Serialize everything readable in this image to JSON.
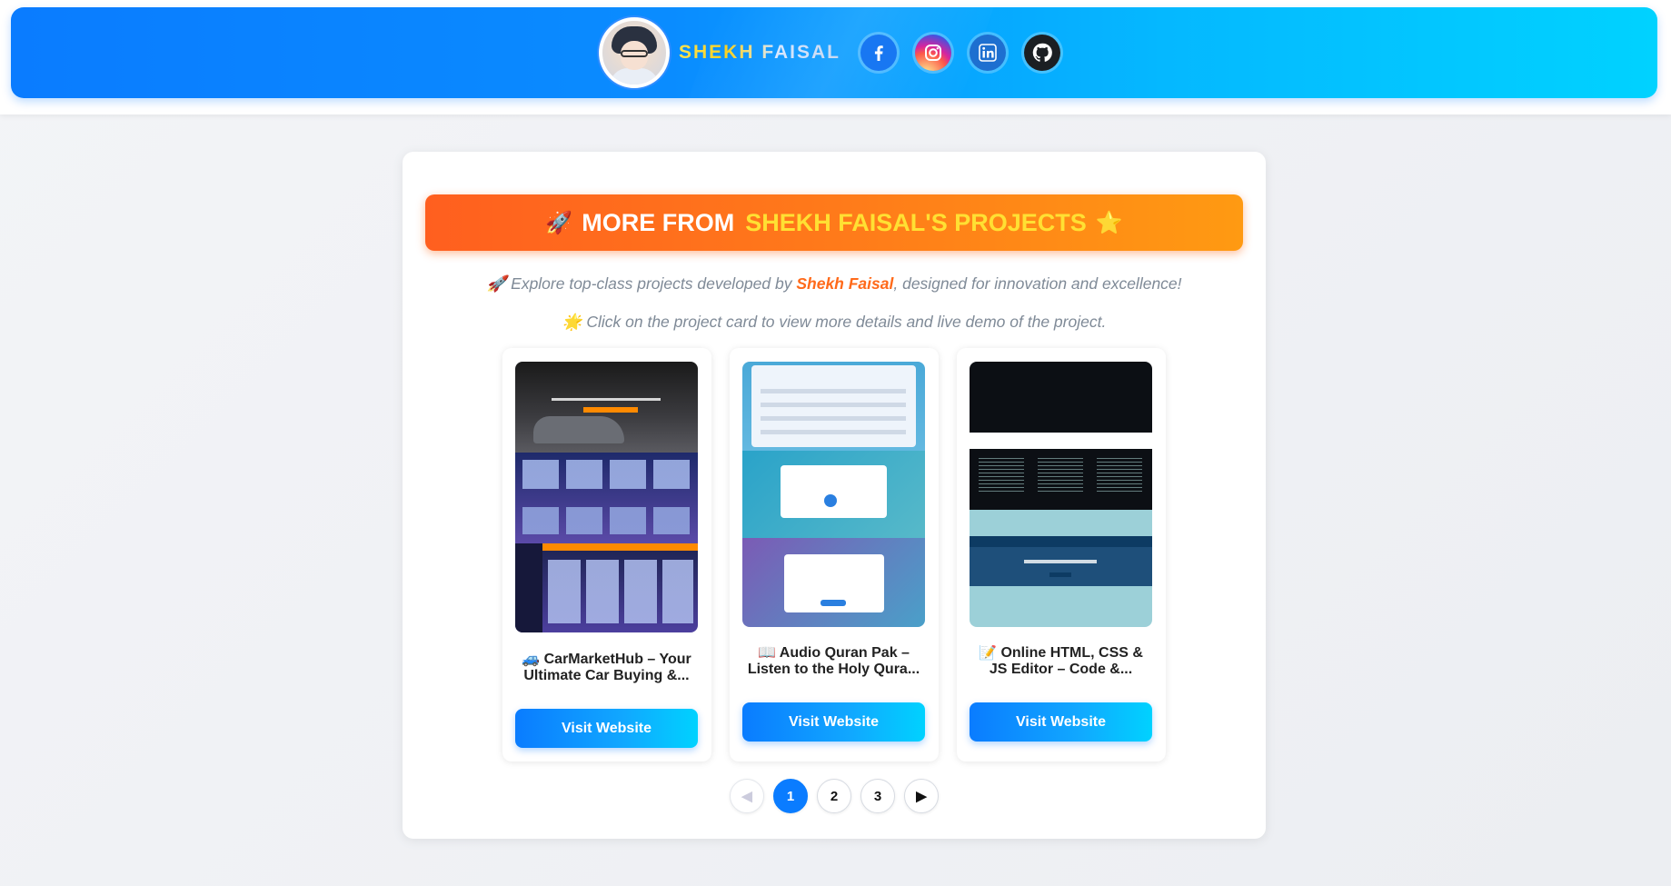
{
  "header": {
    "brand": "SHEKH FAISAL",
    "socials": [
      {
        "name": "facebook",
        "icon": "facebook-icon"
      },
      {
        "name": "instagram",
        "icon": "instagram-icon"
      },
      {
        "name": "linkedin",
        "icon": "linkedin-icon"
      },
      {
        "name": "github",
        "icon": "github-icon"
      }
    ]
  },
  "banner": {
    "emoji_left": "🚀",
    "prefix": "MORE FROM",
    "highlight": "SHEKH FAISAL'S PROJECTS",
    "emoji_right": "⭐"
  },
  "intro": {
    "line1_emoji": "🚀",
    "line1_before": "Explore top-class projects developed by",
    "line1_name": "Shekh Faisal",
    "line1_after": ", designed for innovation and excellence!",
    "line2_emoji": "🌟",
    "line2": "Click on the project card to view more details and live demo of the project."
  },
  "projects": [
    {
      "title_l1": "🚙 CarMarketHub – Your",
      "title_l2": "Ultimate Car Buying &...",
      "button": "Visit Website"
    },
    {
      "title_l1": "📖 Audio Quran Pak –",
      "title_l2": "Listen to the Holy Qura...",
      "button": "Visit Website"
    },
    {
      "title_l1": "📝 Online HTML, CSS &",
      "title_l2": "JS Editor – Code &...",
      "button": "Visit Website"
    }
  ],
  "pagination": {
    "prev": "◀",
    "pages": [
      "1",
      "2",
      "3"
    ],
    "active": "1",
    "next": "▶"
  },
  "colors": {
    "header_start": "#0a7cff",
    "header_end": "#00d2ff",
    "banner_start": "#ff5f1f",
    "banner_end": "#ff9a12",
    "highlight": "#ffe033",
    "button_start": "#0a7cff",
    "button_end": "#00d2ff"
  }
}
